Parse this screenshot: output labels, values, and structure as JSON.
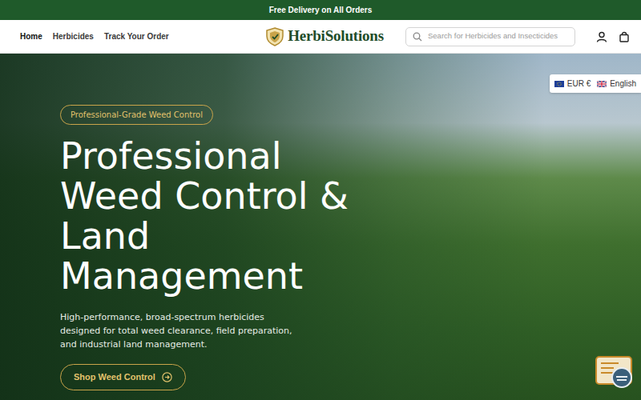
{
  "announcement": "Free Delivery on All Orders",
  "nav": {
    "links": [
      {
        "label": "Home",
        "selected": true
      },
      {
        "label": "Herbicides",
        "selected": false
      },
      {
        "label": "Track Your Order",
        "selected": false
      }
    ]
  },
  "logo": {
    "name": "HerbiSolutions"
  },
  "search": {
    "placeholder": "Search for Herbicides and Insecticides"
  },
  "locale": {
    "currency": "EUR €",
    "language": "English"
  },
  "hero": {
    "badge": "Professional-Grade Weed Control",
    "title": "Professional Weed Control & Land Management",
    "text": "High-performance, broad-spectrum herbicides designed for total weed clearance, field preparation, and industrial land management.",
    "button": "Shop Weed Control"
  }
}
